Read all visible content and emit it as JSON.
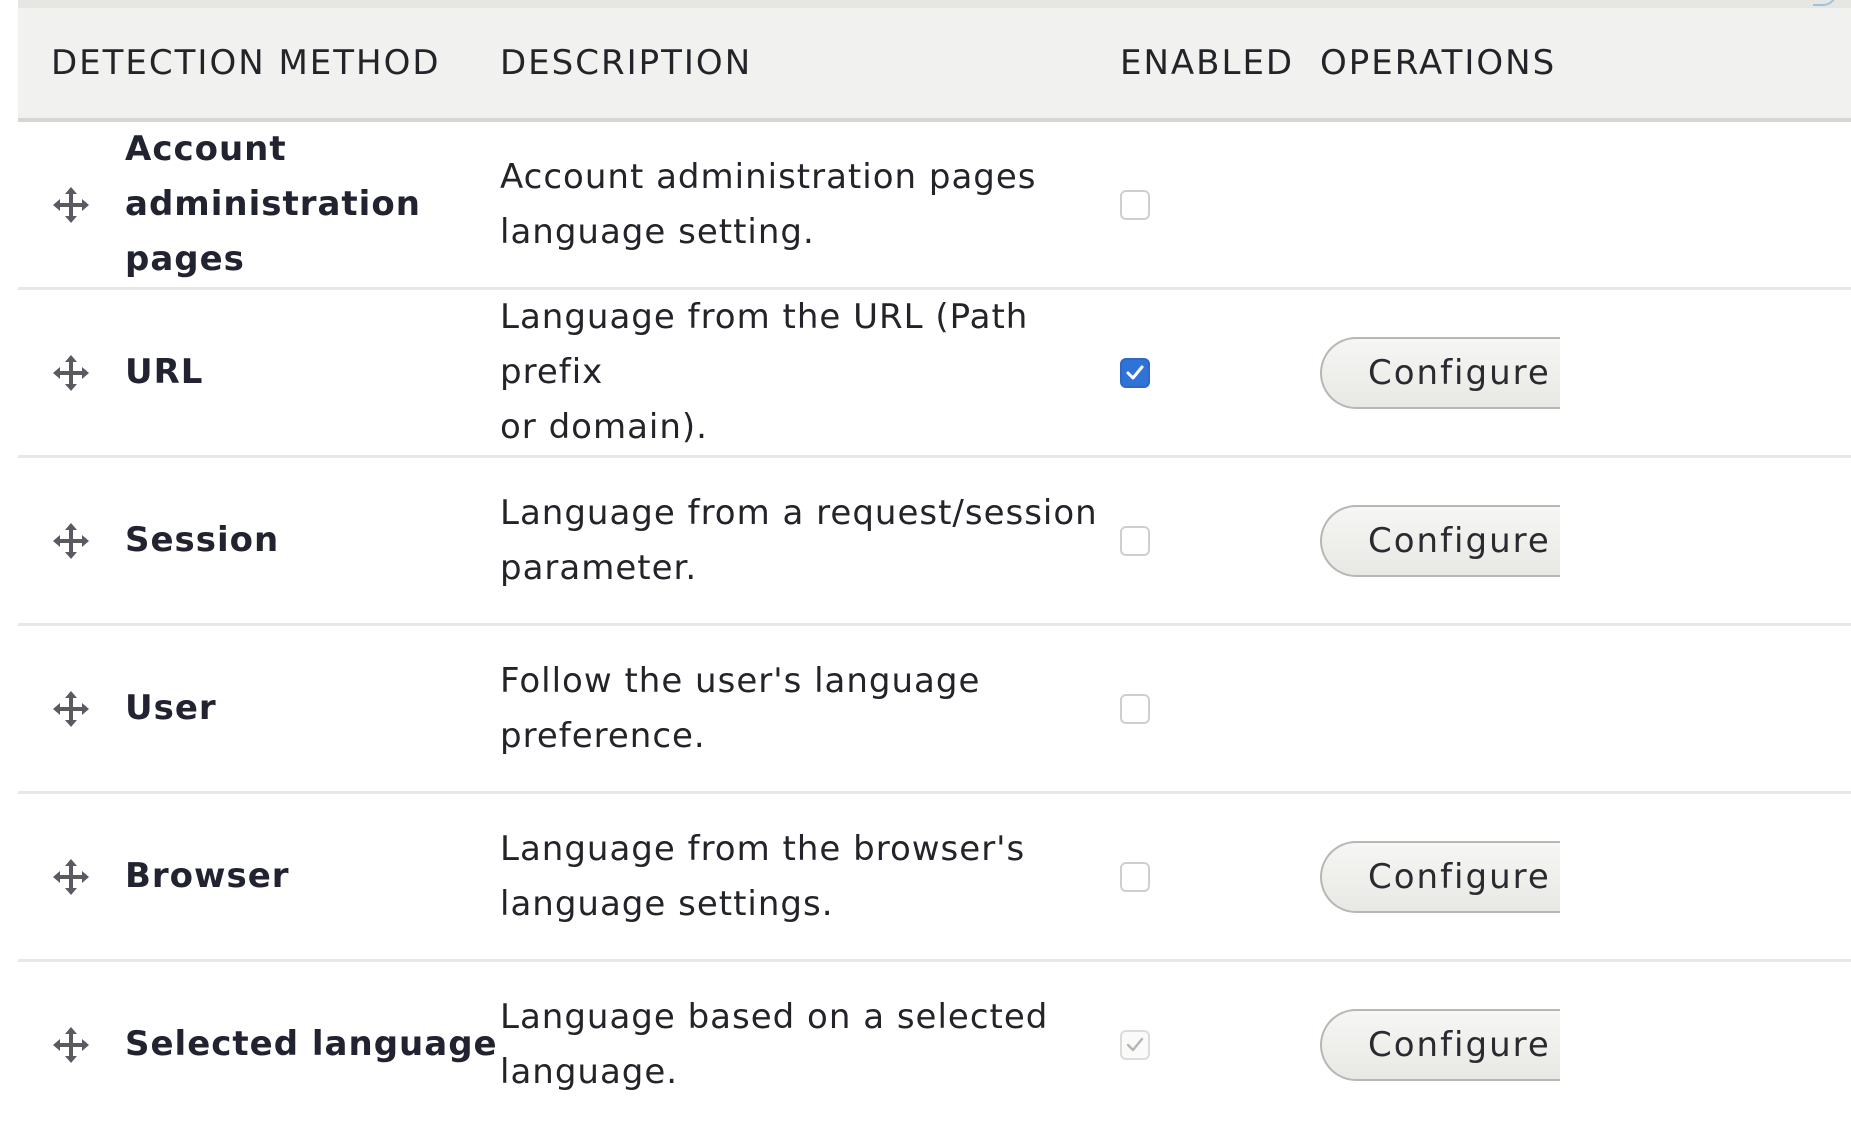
{
  "table": {
    "headers": {
      "method": "DETECTION METHOD",
      "description": "DESCRIPTION",
      "enabled": "ENABLED",
      "operations": "OPERATIONS"
    },
    "rows": [
      {
        "name_line1": "Account",
        "name_line2": "administration pages",
        "description_line1": "Account administration pages",
        "description_line2": "language setting.",
        "enabled": "unchecked",
        "operation": ""
      },
      {
        "name_line1": "URL",
        "name_line2": "",
        "description_line1": "Language from the URL (Path prefix",
        "description_line2": "or domain).",
        "enabled": "checked",
        "operation": "Configure"
      },
      {
        "name_line1": "Session",
        "name_line2": "",
        "description_line1": "Language from a request/session",
        "description_line2": "parameter.",
        "enabled": "unchecked",
        "operation": "Configure"
      },
      {
        "name_line1": "User",
        "name_line2": "",
        "description_line1": "Follow the user's language",
        "description_line2": "preference.",
        "enabled": "unchecked",
        "operation": ""
      },
      {
        "name_line1": "Browser",
        "name_line2": "",
        "description_line1": "Language from the browser's",
        "description_line2": "language settings.",
        "enabled": "unchecked",
        "operation": "Configure"
      },
      {
        "name_line1": "Selected language",
        "name_line2": "",
        "description_line1": "Language based on a selected",
        "description_line2": "language.",
        "enabled": "checked-disabled",
        "operation": "Configure"
      }
    ]
  },
  "colors": {
    "checked_blue": "#2f73d8",
    "header_bg": "#f1f1ef",
    "row_border": "#e7e7e4"
  },
  "icons": {
    "drag": "drag-handle-icon",
    "check": "check-icon"
  }
}
